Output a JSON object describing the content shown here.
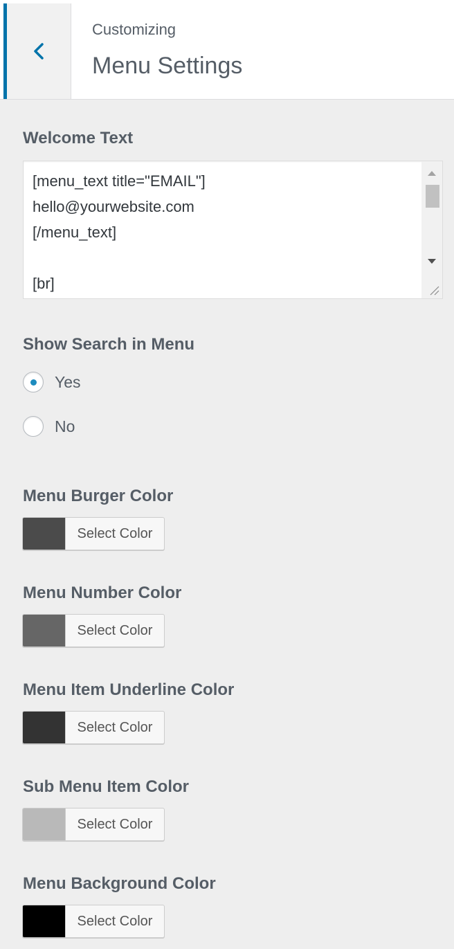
{
  "header": {
    "subtitle": "Customizing",
    "title": "Menu Settings"
  },
  "welcome_text": {
    "label": "Welcome Text",
    "value": "[menu_text title=\"EMAIL\"]\nhello@yourwebsite.com\n[/menu_text]\n\n[br]"
  },
  "search": {
    "label": "Show Search in Menu",
    "options": [
      {
        "label": "Yes",
        "checked": true
      },
      {
        "label": "No",
        "checked": false
      }
    ]
  },
  "colors": [
    {
      "label": "Menu Burger Color",
      "swatch": "#4b4b4b",
      "button": "Select Color"
    },
    {
      "label": "Menu Number Color",
      "swatch": "#666666",
      "button": "Select Color"
    },
    {
      "label": "Menu Item Underline Color",
      "swatch": "#333333",
      "button": "Select Color"
    },
    {
      "label": "Sub Menu Item Color",
      "swatch": "#b9b9b9",
      "button": "Select Color"
    },
    {
      "label": "Menu Background Color",
      "swatch": "#000000",
      "button": "Select Color"
    }
  ],
  "icons": {
    "back": "chevron-left-icon",
    "resize": "resize-handle-icon"
  },
  "theme": {
    "accent": "#0073aa",
    "radio_dot": "#1e8cbe"
  }
}
